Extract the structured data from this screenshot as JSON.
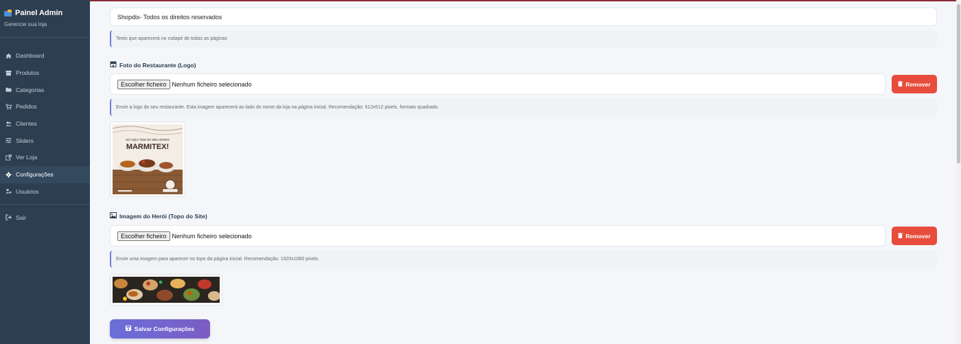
{
  "sidebar": {
    "title": "Painel Admin",
    "subtitle": "Gerencie sua loja",
    "items": [
      {
        "label": "Dashboard",
        "icon": "home-icon"
      },
      {
        "label": "Produtos",
        "icon": "box-icon"
      },
      {
        "label": "Categorias",
        "icon": "folder-icon"
      },
      {
        "label": "Pedidos",
        "icon": "cart-icon"
      },
      {
        "label": "Clientes",
        "icon": "users-icon"
      },
      {
        "label": "Sliders",
        "icon": "sliders-icon"
      },
      {
        "label": "Ver Loja",
        "icon": "external-link-icon"
      },
      {
        "label": "Configurações",
        "icon": "gear-icon"
      },
      {
        "label": "Usuários",
        "icon": "user-cog-icon"
      }
    ],
    "logout": {
      "label": "Sair",
      "icon": "sign-out-icon"
    }
  },
  "footer_text": {
    "value": "Shopdix- Todos os direitos reservados",
    "hint": "Texto que aparecerá no rodapé de todas as páginas"
  },
  "logo_section": {
    "label": "Foto do Restaurante (Logo)",
    "file_button": "Escolher ficheiro",
    "file_status": "Nenhum ficheiro selecionado",
    "remove_label": "Remover",
    "hint": "Envie a logo do seu restaurante. Esta imagem aparecerá ao lado do nome da loja na página inicial. Recomendação: 512x512 pixels, formato quadrado.",
    "preview": {
      "top_text": "SÓ AQUI TEM OS MELHORES",
      "main_text": "MARMITEX!"
    }
  },
  "hero_section": {
    "label": "Imagem do Herói (Topo do Site)",
    "file_button": "Escolher ficheiro",
    "file_status": "Nenhum ficheiro selecionado",
    "remove_label": "Remover",
    "hint": "Envie uma imagem para aparecer no topo da página inicial. Recomendação: 1920x1080 pixels."
  },
  "save_button": {
    "label": "Salvar Configurações"
  },
  "colors": {
    "sidebar_bg": "#2c3e50",
    "remove_red": "#e74c3c",
    "save_gradient_start": "#6a6fd8",
    "save_gradient_end": "#7b5cc4",
    "hint_border": "#6b7ad6"
  }
}
